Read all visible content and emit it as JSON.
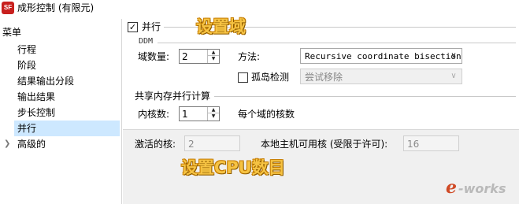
{
  "window": {
    "title": "成形控制 (有限元)",
    "icon": "app-logo-icon"
  },
  "sidebar": {
    "header": "菜单",
    "items": [
      {
        "label": "行程"
      },
      {
        "label": "阶段"
      },
      {
        "label": "结果输出分段"
      },
      {
        "label": "输出结果"
      },
      {
        "label": "步长控制"
      },
      {
        "label": "并行",
        "selected": true
      },
      {
        "label": "高级的",
        "expandable": true
      }
    ],
    "selected_color": "#cde8ff"
  },
  "parallel": {
    "checkbox_label": "并行",
    "checked": true,
    "ddm_title": "DDM",
    "domain_count_label": "域数量:",
    "domain_count_value": "2",
    "method_label": "方法:",
    "method_value": "Recursive coordinate bisection",
    "island_check_label": "孤岛检测",
    "island_checked": false,
    "island_value": "尝试移除",
    "shared_memory_title": "共享内存并行计算",
    "cores_label": "内核数:",
    "cores_value": "1",
    "cores_per_domain_label": "每个域的核数",
    "active_cores_label": "激活的核:",
    "active_cores_value": "2",
    "local_cores_label": "本地主机可用核 (受限于许可):",
    "local_cores_value": "16"
  },
  "annotations": {
    "domain_overlay": "设置域",
    "cpu_overlay": "设置CPU数目",
    "color": "#f6c343"
  },
  "watermark": {
    "e": "e",
    "rest": "-works"
  }
}
